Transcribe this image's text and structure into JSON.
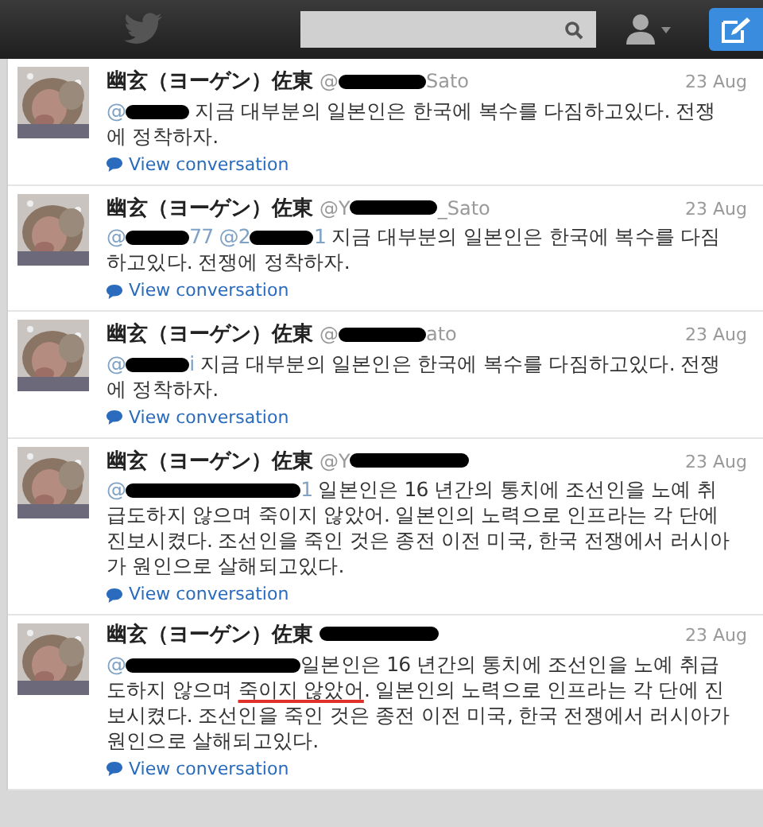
{
  "tweets": [
    {
      "name": "幽玄（ヨーゲン）佐東",
      "handle_before": "@",
      "handle_after": "Sato",
      "date": "23 Aug",
      "body": [
        {
          "kind": "mention",
          "text": "@"
        },
        {
          "kind": "redacted"
        },
        {
          "kind": "text",
          "text": " 지금 대부분의 일본인은 한국에 복수를 다짐하고있다. 전쟁에 정착하자."
        }
      ],
      "link": "View conversation"
    },
    {
      "name": "幽玄（ヨーゲン）佐東",
      "handle_before": "@Y",
      "handle_after": "_Sato",
      "date": "23 Aug",
      "body": [
        {
          "kind": "mention",
          "text": "@"
        },
        {
          "kind": "redacted"
        },
        {
          "kind": "mention",
          "text": "77 @2"
        },
        {
          "kind": "redacted"
        },
        {
          "kind": "mention",
          "text": "1"
        },
        {
          "kind": "text",
          "text": " 지금 대부분의 일본인은 한국에 복수를 다짐하고있다. 전쟁에 정착하자."
        }
      ],
      "link": "View conversation"
    },
    {
      "name": "幽玄（ヨーゲン）佐東",
      "handle_before": "@",
      "handle_after": "ato",
      "date": "23 Aug",
      "body": [
        {
          "kind": "mention",
          "text": "@"
        },
        {
          "kind": "redacted"
        },
        {
          "kind": "mention",
          "text": "i"
        },
        {
          "kind": "text",
          "text": " 지금 대부분의 일본인은 한국에 복수를 다짐하고있다. 전쟁에 정착하자."
        }
      ],
      "link": "View conversation"
    },
    {
      "name": "幽玄（ヨーゲン）佐東",
      "handle_before": "@Y",
      "date": "23 Aug",
      "body": [
        {
          "kind": "mention",
          "text": "@"
        },
        {
          "kind": "redacted"
        },
        {
          "kind": "mention",
          "text": "1"
        },
        {
          "kind": "text",
          "text": " 일본인은 16 년간의 통치에 조선인을 노예 취급도하지 않으며 죽이지 않았어. 일본인의 노력으로 인프라는 각 단에 진보시켰다. 조선인을 죽인 것은 종전 이전 미국, 한국 전쟁에서 러시아가 원인으로 살해되고있다."
        }
      ],
      "link": "View conversation"
    },
    {
      "name": "幽玄（ヨーゲン）佐東",
      "date": "23 Aug",
      "body": [
        {
          "kind": "mention",
          "text": "@"
        },
        {
          "kind": "redacted"
        },
        {
          "kind": "text",
          "text": "일본인은 16 년간의 통치에 조선인을 노예 취급도하지 않으며 "
        },
        {
          "kind": "underlined",
          "text": "죽이지 않았어"
        },
        {
          "kind": "text",
          "text": ". 일본인의 노력으로 인프라는 각 단에 진보시켰다. 조선인을 죽인 것은 종전 이전 미국, 한국 전쟁에서 러시아가 원인으로 살해되고있다."
        }
      ],
      "link": "View conversation"
    }
  ]
}
